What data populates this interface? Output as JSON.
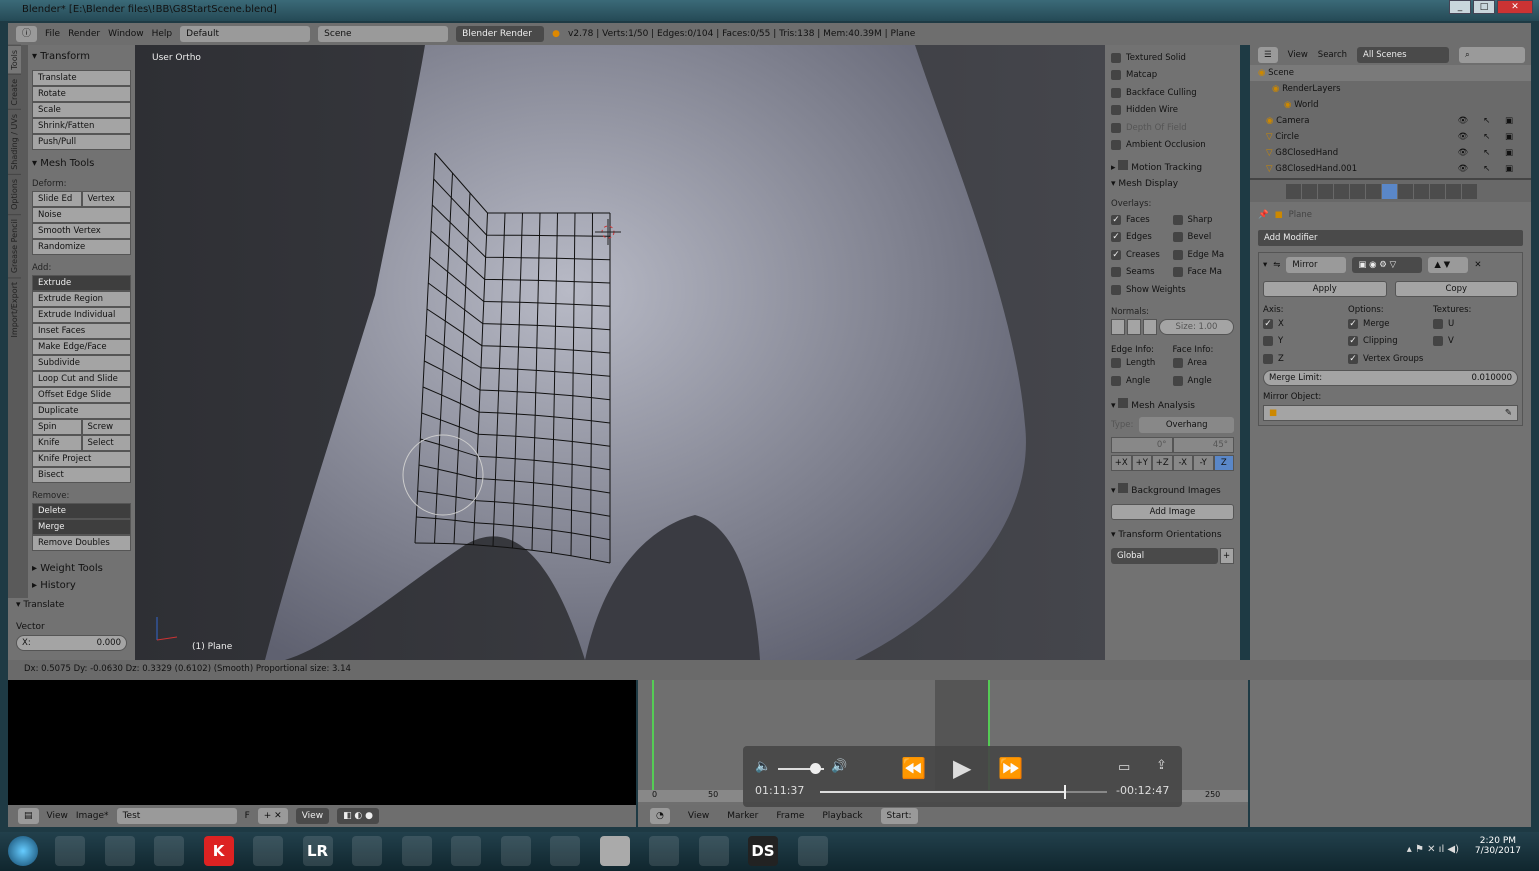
{
  "window": {
    "title": "Blender* [E:\\Blender files\\!BB\\G8StartScene.blend]"
  },
  "info_header": {
    "menus": [
      "File",
      "Render",
      "Window",
      "Help"
    ],
    "layout": "Default",
    "scene": "Scene",
    "engine": "Blender Render",
    "stats": "v2.78 | Verts:1/50 | Edges:0/104 | Faces:0/55 | Tris:138 | Mem:40.39M | Plane"
  },
  "tool_tabs": [
    "Tools",
    "Create",
    "Shading / UVs",
    "Options",
    "Grease Pencil",
    "Import/Export"
  ],
  "toolshelf": {
    "transform_title": "Transform",
    "transform": [
      "Translate",
      "Rotate",
      "Scale",
      "Shrink/Fatten",
      "Push/Pull"
    ],
    "mesh_tools_title": "Mesh Tools",
    "deform_label": "Deform:",
    "slide_edge": "Slide Ed",
    "vertex": "Vertex",
    "deform": [
      "Noise",
      "Smooth Vertex",
      "Randomize"
    ],
    "add_label": "Add:",
    "extrude": "Extrude",
    "add": [
      "Extrude Region",
      "Extrude Individual",
      "Inset Faces",
      "Make Edge/Face",
      "Subdivide",
      "Loop Cut and Slide",
      "Offset Edge Slide",
      "Duplicate"
    ],
    "spin": "Spin",
    "screw": "Screw",
    "knife": "Knife",
    "select": "Select",
    "knife_project": "Knife Project",
    "bisect": "Bisect",
    "remove_label": "Remove:",
    "delete": "Delete",
    "merge": "Merge",
    "remove_doubles": "Remove Doubles",
    "weight_tools": "Weight Tools",
    "history": "History",
    "translate_title": "Translate",
    "vector_label": "Vector",
    "x_label": "X:",
    "x_value": "0.000"
  },
  "viewport": {
    "view_label": "User Ortho",
    "object_label": "(1) Plane"
  },
  "npanel": {
    "shading": [
      {
        "label": "Textured Solid",
        "checked": false
      },
      {
        "label": "Matcap",
        "checked": false
      },
      {
        "label": "Backface Culling",
        "checked": false
      },
      {
        "label": "Hidden Wire",
        "checked": false
      },
      {
        "label": "Depth Of Field",
        "checked": false
      },
      {
        "label": "Ambient Occlusion",
        "checked": false
      }
    ],
    "motion_tracking": "Motion Tracking",
    "mesh_display": "Mesh Display",
    "overlays_label": "Overlays:",
    "overlays_left": [
      {
        "label": "Faces",
        "checked": true
      },
      {
        "label": "Edges",
        "checked": true
      },
      {
        "label": "Creases",
        "checked": true
      },
      {
        "label": "Seams",
        "checked": false
      }
    ],
    "overlays_right": [
      {
        "label": "Sharp",
        "checked": false
      },
      {
        "label": "Bevel",
        "checked": false
      },
      {
        "label": "Edge Ma",
        "checked": false
      },
      {
        "label": "Face Ma",
        "checked": false
      }
    ],
    "show_weights": "Show Weights",
    "normals_label": "Normals:",
    "normals_size": "Size: 1.00",
    "edge_info": "Edge Info:",
    "face_info": "Face Info:",
    "length": "Length",
    "angle": "Angle",
    "area": "Area",
    "angle2": "Angle",
    "mesh_analysis": "Mesh Analysis",
    "type_label": "Type:",
    "type_value": "Overhang",
    "min": "0°",
    "max": "45°",
    "axes": [
      "+X",
      "+Y",
      "+Z",
      "-X",
      "-Y",
      "Z"
    ],
    "background_images": "Background Images",
    "add_image": "Add Image",
    "transform_orientations": "Transform Orientations",
    "orientation": "Global"
  },
  "outliner": {
    "view": "View",
    "search": "Search",
    "filter": "All Scenes",
    "items": [
      {
        "name": "Scene"
      },
      {
        "name": "RenderLayers"
      },
      {
        "name": "World"
      },
      {
        "name": "Camera"
      },
      {
        "name": "Circle"
      },
      {
        "name": "G8ClosedHand"
      },
      {
        "name": "G8ClosedHand.001"
      }
    ]
  },
  "properties": {
    "object": "Plane",
    "add_modifier": "Add Modifier",
    "modifier_name": "Mirror",
    "apply": "Apply",
    "copy": "Copy",
    "axis_label": "Axis:",
    "options_label": "Options:",
    "textures_label": "Textures:",
    "axis": [
      {
        "label": "X",
        "checked": true
      },
      {
        "label": "Y",
        "checked": false
      },
      {
        "label": "Z",
        "checked": false
      }
    ],
    "options": [
      {
        "label": "Merge",
        "checked": true
      },
      {
        "label": "Clipping",
        "checked": true
      },
      {
        "label": "Vertex Groups",
        "checked": true
      }
    ],
    "textures": [
      {
        "label": "U",
        "checked": false
      },
      {
        "label": "V",
        "checked": false
      }
    ],
    "merge_limit_label": "Merge Limit:",
    "merge_limit": "0.010000",
    "mirror_object": "Mirror Object:"
  },
  "status": "Dx: 0.5075  Dy: -0.0630  Dz: 0.3329 (0.6102) (Smooth)  Proportional size: 3.14",
  "image_editor": {
    "menus": [
      "View",
      "Image*"
    ],
    "image": "Test",
    "f": "F",
    "view": "View"
  },
  "timeline": {
    "ticks": [
      "0",
      "50",
      "250"
    ],
    "menus": [
      "View",
      "Marker",
      "Frame",
      "Playback"
    ],
    "start": "Start:"
  },
  "video": {
    "elapsed": "01:11:37",
    "remaining": "-00:12:47",
    "progress": 0.85,
    "volume": 0.7
  },
  "taskbar": {
    "time": "2:20 PM",
    "date": "7/30/2017",
    "apps": [
      "Explorer",
      "Media",
      "Tool",
      "K",
      "Chrome",
      "LR",
      "Firefox",
      "Files",
      "Globe",
      "Window",
      "Pad",
      "Blender",
      "Gear",
      "Network",
      "DS",
      "Firefox2"
    ]
  }
}
